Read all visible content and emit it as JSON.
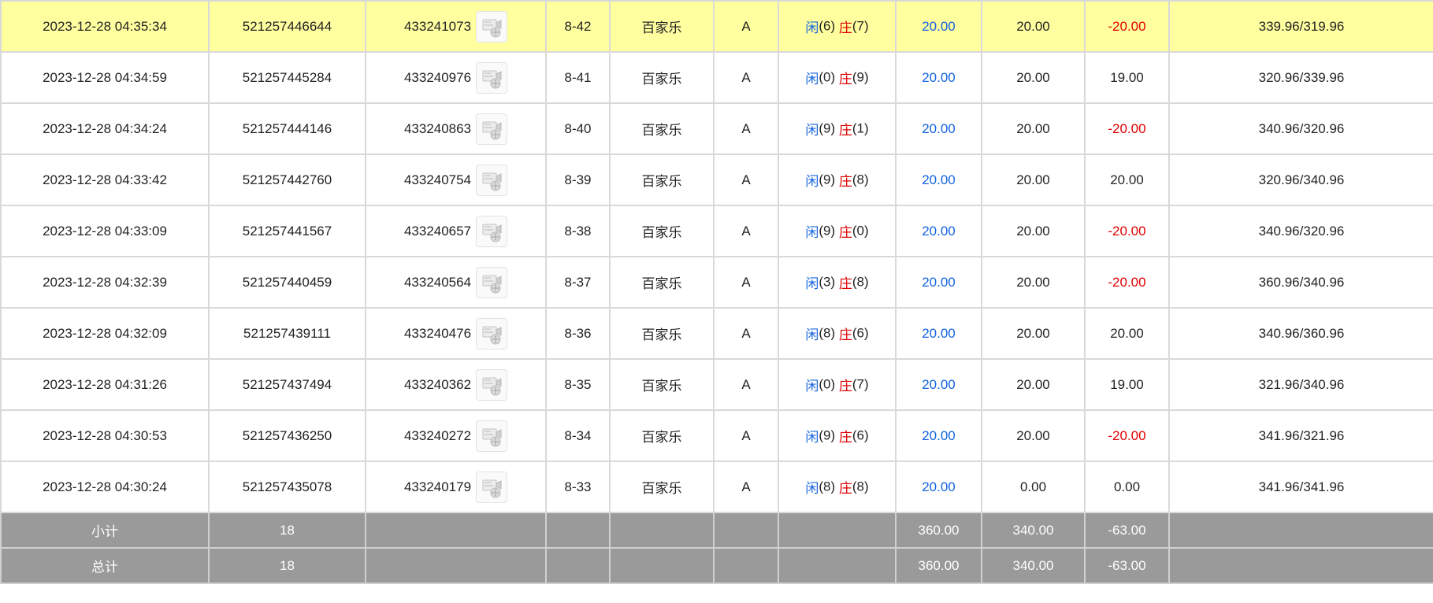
{
  "colors": {
    "highlight_row": "#ffffa0",
    "summary_bg": "#9a9a9a",
    "player_blue": "#1565e0",
    "loss_red": "#e00000"
  },
  "icons": {
    "replay": "video-replay-icon"
  },
  "rows": [
    {
      "time": "2023-12-28 04:35:34",
      "order_id": "521257446644",
      "bet_id": "433241073",
      "round": "8-42",
      "game": "百家乐",
      "table": "A",
      "player_label": "闲",
      "player_score": "(6)",
      "banker_label": "庄",
      "banker_score": "(7)",
      "bet": "20.00",
      "valid_bet": "20.00",
      "win_loss": "-20.00",
      "balance": "339.96/319.96"
    },
    {
      "time": "2023-12-28 04:34:59",
      "order_id": "521257445284",
      "bet_id": "433240976",
      "round": "8-41",
      "game": "百家乐",
      "table": "A",
      "player_label": "闲",
      "player_score": "(0)",
      "banker_label": "庄",
      "banker_score": "(9)",
      "bet": "20.00",
      "valid_bet": "20.00",
      "win_loss": "19.00",
      "balance": "320.96/339.96"
    },
    {
      "time": "2023-12-28 04:34:24",
      "order_id": "521257444146",
      "bet_id": "433240863",
      "round": "8-40",
      "game": "百家乐",
      "table": "A",
      "player_label": "闲",
      "player_score": "(9)",
      "banker_label": "庄",
      "banker_score": "(1)",
      "bet": "20.00",
      "valid_bet": "20.00",
      "win_loss": "-20.00",
      "balance": "340.96/320.96"
    },
    {
      "time": "2023-12-28 04:33:42",
      "order_id": "521257442760",
      "bet_id": "433240754",
      "round": "8-39",
      "game": "百家乐",
      "table": "A",
      "player_label": "闲",
      "player_score": "(9)",
      "banker_label": "庄",
      "banker_score": "(8)",
      "bet": "20.00",
      "valid_bet": "20.00",
      "win_loss": "20.00",
      "balance": "320.96/340.96"
    },
    {
      "time": "2023-12-28 04:33:09",
      "order_id": "521257441567",
      "bet_id": "433240657",
      "round": "8-38",
      "game": "百家乐",
      "table": "A",
      "player_label": "闲",
      "player_score": "(9)",
      "banker_label": "庄",
      "banker_score": "(0)",
      "bet": "20.00",
      "valid_bet": "20.00",
      "win_loss": "-20.00",
      "balance": "340.96/320.96"
    },
    {
      "time": "2023-12-28 04:32:39",
      "order_id": "521257440459",
      "bet_id": "433240564",
      "round": "8-37",
      "game": "百家乐",
      "table": "A",
      "player_label": "闲",
      "player_score": "(3)",
      "banker_label": "庄",
      "banker_score": "(8)",
      "bet": "20.00",
      "valid_bet": "20.00",
      "win_loss": "-20.00",
      "balance": "360.96/340.96"
    },
    {
      "time": "2023-12-28 04:32:09",
      "order_id": "521257439111",
      "bet_id": "433240476",
      "round": "8-36",
      "game": "百家乐",
      "table": "A",
      "player_label": "闲",
      "player_score": "(8)",
      "banker_label": "庄",
      "banker_score": "(6)",
      "bet": "20.00",
      "valid_bet": "20.00",
      "win_loss": "20.00",
      "balance": "340.96/360.96"
    },
    {
      "time": "2023-12-28 04:31:26",
      "order_id": "521257437494",
      "bet_id": "433240362",
      "round": "8-35",
      "game": "百家乐",
      "table": "A",
      "player_label": "闲",
      "player_score": "(0)",
      "banker_label": "庄",
      "banker_score": "(7)",
      "bet": "20.00",
      "valid_bet": "20.00",
      "win_loss": "19.00",
      "balance": "321.96/340.96"
    },
    {
      "time": "2023-12-28 04:30:53",
      "order_id": "521257436250",
      "bet_id": "433240272",
      "round": "8-34",
      "game": "百家乐",
      "table": "A",
      "player_label": "闲",
      "player_score": "(9)",
      "banker_label": "庄",
      "banker_score": "(6)",
      "bet": "20.00",
      "valid_bet": "20.00",
      "win_loss": "-20.00",
      "balance": "341.96/321.96"
    },
    {
      "time": "2023-12-28 04:30:24",
      "order_id": "521257435078",
      "bet_id": "433240179",
      "round": "8-33",
      "game": "百家乐",
      "table": "A",
      "player_label": "闲",
      "player_score": "(8)",
      "banker_label": "庄",
      "banker_score": "(8)",
      "bet": "20.00",
      "valid_bet": "0.00",
      "win_loss": "0.00",
      "balance": "341.96/341.96"
    }
  ],
  "subtotal": {
    "label": "小计",
    "count": "18",
    "bet": "360.00",
    "valid_bet": "340.00",
    "win_loss": "-63.00"
  },
  "total": {
    "label": "总计",
    "count": "18",
    "bet": "360.00",
    "valid_bet": "340.00",
    "win_loss": "-63.00"
  }
}
